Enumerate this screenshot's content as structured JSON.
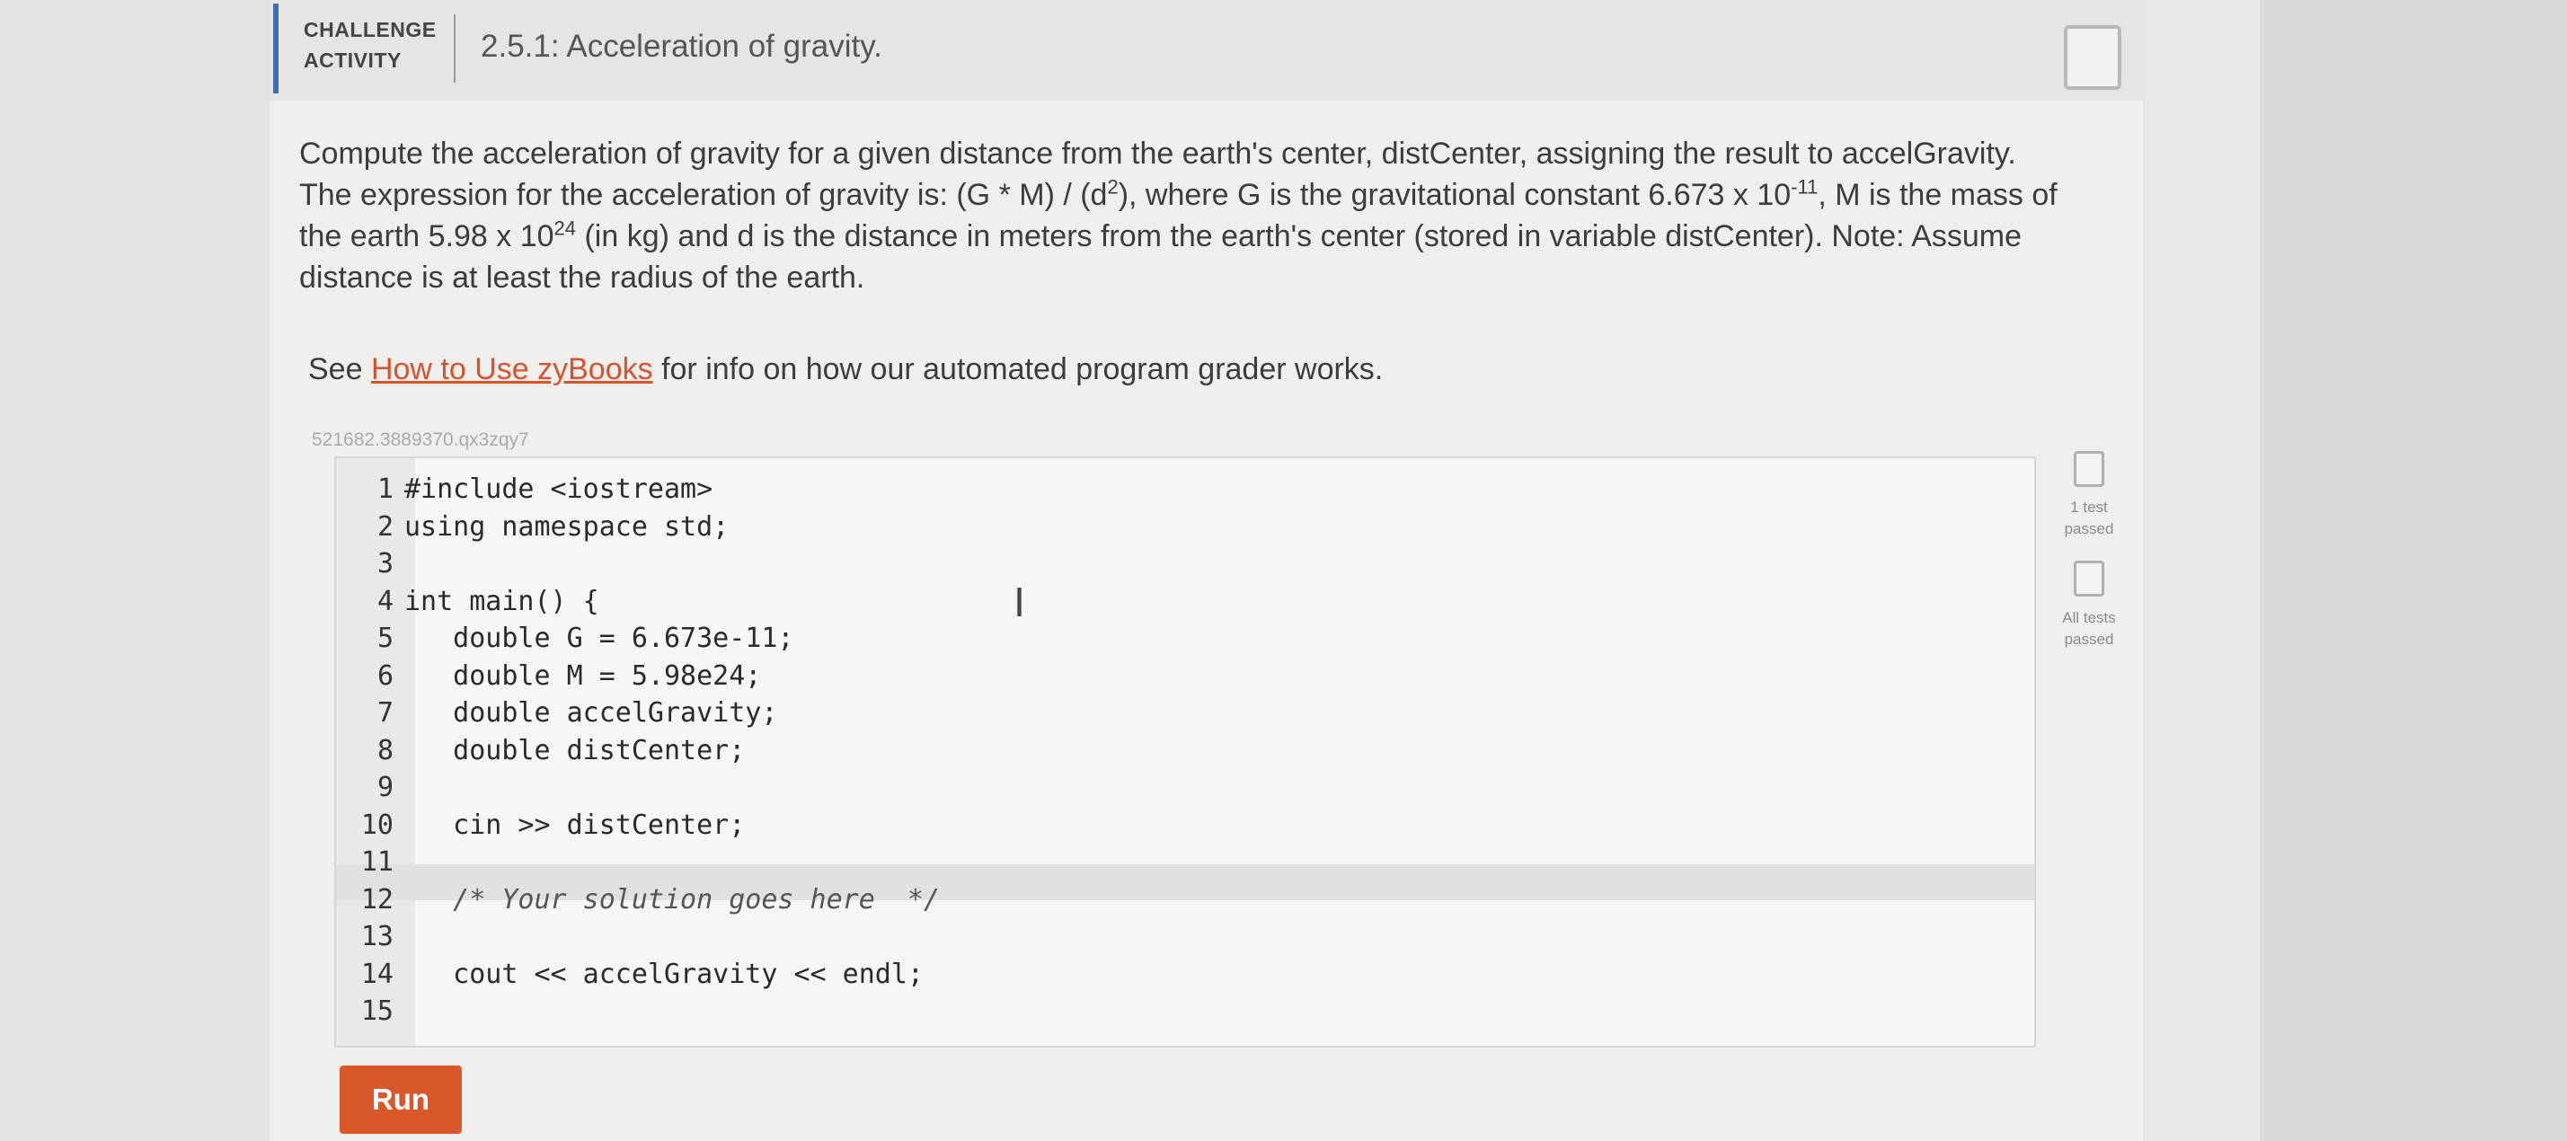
{
  "header": {
    "label": "CHALLENGE\nACTIVITY",
    "title": "2.5.1: Acceleration of gravity."
  },
  "prompt": {
    "line1": "Compute the acceleration of gravity for a given distance from the earth's center, distCenter, assigning the result to accelGravity.",
    "line2_a": "The expression for the acceleration of gravity is: (G * M) / (d",
    "line2_sup1": "2",
    "line2_b": "), where G is the gravitational constant 6.673 x 10",
    "line2_sup2": "-11",
    "line2_c": ", M is the mass of",
    "line3_a": "the earth 5.98 x 10",
    "line3_sup": "24",
    "line3_b": " (in kg) and d is the distance in meters from the earth's center (stored in variable distCenter). Note: Assume",
    "line4": "distance is at least the radius of the earth."
  },
  "help": {
    "prefix": "See ",
    "link": "How to Use zyBooks",
    "suffix": " for info on how our automated program grader works."
  },
  "code_id": "521682.3889370.qx3zqy7",
  "code_lines": [
    {
      "num": "1",
      "text": "#include <iostream>"
    },
    {
      "num": "2",
      "text": "using namespace std;"
    },
    {
      "num": "3",
      "text": ""
    },
    {
      "num": "4",
      "text": "int main() {"
    },
    {
      "num": "5",
      "text": "   double G = 6.673e-11;"
    },
    {
      "num": "6",
      "text": "   double M = 5.98e24;"
    },
    {
      "num": "7",
      "text": "   double accelGravity;"
    },
    {
      "num": "8",
      "text": "   double distCenter;"
    },
    {
      "num": "9",
      "text": ""
    },
    {
      "num": "10",
      "text": "   cin >> distCenter;"
    },
    {
      "num": "11",
      "text": ""
    },
    {
      "num": "12",
      "text": "   /* Your solution goes here  */"
    },
    {
      "num": "13",
      "text": ""
    },
    {
      "num": "14",
      "text": "   cout << accelGravity << endl;"
    },
    {
      "num": "15",
      "text": ""
    }
  ],
  "status": {
    "test1": "1 test\npassed",
    "all": "All tests\npassed"
  },
  "run_label": "Run"
}
